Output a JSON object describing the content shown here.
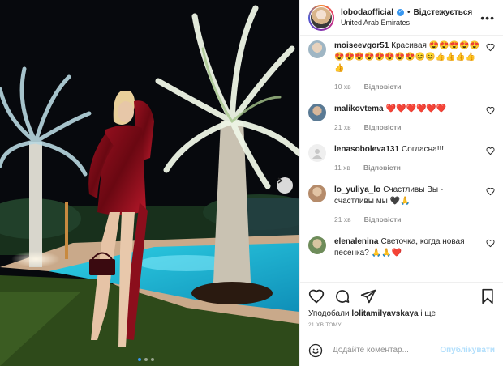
{
  "header": {
    "username": "lobodaofficial",
    "separator": "•",
    "follow_label": "Відстежується",
    "location": "United Arab Emirates",
    "more_icon": "more-horizontal-icon"
  },
  "comments": [
    {
      "user": "moiseevgor51",
      "text": "Красивая 😍😍😍😍😍😍😍😍😍😍😍😍😍😊😊👍👍👍👍👍",
      "time": "10 хв",
      "reply": "Відповісти"
    },
    {
      "user": "malikovtema",
      "text": "❤️❤️❤️❤️❤️❤️",
      "time": "21 хв",
      "reply": "Відповісти"
    },
    {
      "user": "lenasoboleva131",
      "text": "Согласна!!!!",
      "time": "11 хв",
      "reply": "Відповісти"
    },
    {
      "user": "lo_yuliya_lo",
      "text": "Счастливы Вы - счастливы мы 🖤🙏",
      "time": "21 хв",
      "reply": "Відповісти"
    },
    {
      "user": "elenalenina",
      "text": "Светочка, когда новая песенка? 🙏🙏❤️",
      "time": "",
      "reply": ""
    }
  ],
  "likes": {
    "prefix": "Уподобали",
    "user": "lolitamilyavskaya",
    "suffix": "і ще"
  },
  "timestamp": "21 ХВ ТОМУ",
  "add_comment": {
    "placeholder": "Додайте коментар...",
    "post_label": "Опублікувати"
  },
  "carousel": {
    "current": 1,
    "total": 3
  },
  "colors": {
    "accent": "#3897f0",
    "like_red": "#ed4956",
    "post_disabled": "#b2dffc"
  }
}
